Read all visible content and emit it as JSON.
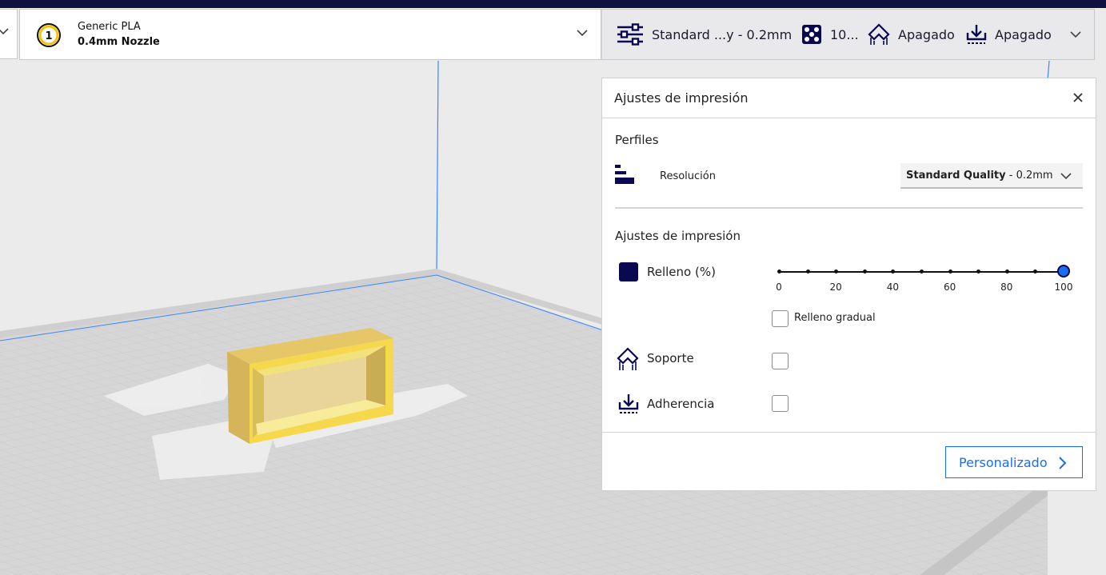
{
  "extruder": {
    "number": "1",
    "material_name": "Generic PLA",
    "nozzle": "0.4mm Nozzle"
  },
  "summary": {
    "profile": "Standard ...y - 0.2mm",
    "infill": "10...",
    "support": "Apagado",
    "adhesion": "Apagado"
  },
  "print_panel": {
    "title": "Ajustes de impresión",
    "profiles_label": "Perfiles",
    "resolution_label": "Resolución",
    "resolution_value_bold": "Standard Quality",
    "resolution_value_rest": " - 0.2mm",
    "settings_label": "Ajustes de impresión",
    "infill_label": "Relleno (%)",
    "infill_value": 100,
    "infill_ticks": [
      "0",
      "20",
      "40",
      "60",
      "80",
      "100"
    ],
    "gradual_label": "Relleno gradual",
    "gradual_checked": false,
    "support_label": "Soporte",
    "support_checked": false,
    "adhesion_label": "Adherencia",
    "adhesion_checked": false,
    "custom_button": "Personalizado"
  },
  "colors": {
    "accent": "#196ef0",
    "dark": "#0a0850",
    "model": "#f5d84c"
  }
}
